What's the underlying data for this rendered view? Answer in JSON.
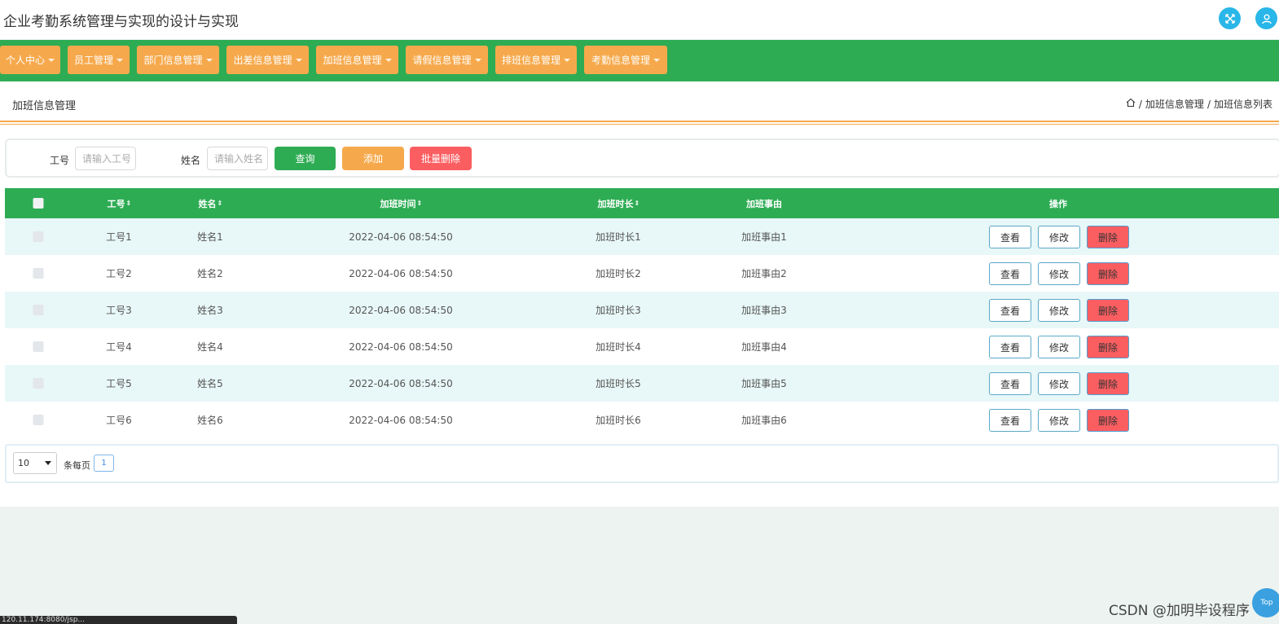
{
  "app": {
    "title": "企业考勤系统管理与实现的设计与实现"
  },
  "header_icons": [
    {
      "name": "fullscreen-icon"
    },
    {
      "name": "user-icon"
    }
  ],
  "nav": {
    "items": [
      {
        "label": "个人中心"
      },
      {
        "label": "员工管理"
      },
      {
        "label": "部门信息管理"
      },
      {
        "label": "出差信息管理"
      },
      {
        "label": "加班信息管理"
      },
      {
        "label": "请假信息管理"
      },
      {
        "label": "排班信息管理"
      },
      {
        "label": "考勤信息管理"
      }
    ]
  },
  "page": {
    "title": "加班信息管理",
    "breadcrumb": {
      "home_icon": "home-icon",
      "sep": "/",
      "level1": "加班信息管理",
      "level2": "加班信息列表"
    }
  },
  "search": {
    "employee_id_label": "工号",
    "employee_id_placeholder": "请输入工号",
    "name_label": "姓名",
    "name_placeholder": "请输入姓名",
    "query_button": "查询",
    "add_button": "添加",
    "batch_delete_button": "批量删除"
  },
  "table": {
    "columns": {
      "employee_id": "工号",
      "name": "姓名",
      "overtime_time": "加班时间",
      "overtime_duration": "加班时长",
      "overtime_reason": "加班事由",
      "actions": "操作"
    },
    "sort_icon": "⇕",
    "rows": [
      {
        "employee_id": "工号1",
        "name": "姓名1",
        "overtime_time": "2022-04-06 08:54:50",
        "overtime_duration": "加班时长1",
        "overtime_reason": "加班事由1"
      },
      {
        "employee_id": "工号2",
        "name": "姓名2",
        "overtime_time": "2022-04-06 08:54:50",
        "overtime_duration": "加班时长2",
        "overtime_reason": "加班事由2"
      },
      {
        "employee_id": "工号3",
        "name": "姓名3",
        "overtime_time": "2022-04-06 08:54:50",
        "overtime_duration": "加班时长3",
        "overtime_reason": "加班事由3"
      },
      {
        "employee_id": "工号4",
        "name": "姓名4",
        "overtime_time": "2022-04-06 08:54:50",
        "overtime_duration": "加班时长4",
        "overtime_reason": "加班事由4"
      },
      {
        "employee_id": "工号5",
        "name": "姓名5",
        "overtime_time": "2022-04-06 08:54:50",
        "overtime_duration": "加班时长5",
        "overtime_reason": "加班事由5"
      },
      {
        "employee_id": "工号6",
        "name": "姓名6",
        "overtime_time": "2022-04-06 08:54:50",
        "overtime_duration": "加班时长6",
        "overtime_reason": "加班事由6"
      }
    ],
    "action_labels": {
      "view": "查看",
      "edit": "修改",
      "delete": "删除"
    }
  },
  "pagination": {
    "page_size": "10",
    "per_page_label": "条每页",
    "current_page": "1"
  },
  "status_bar_url": "120.11.174:8080/jsp...",
  "watermark": "CSDN @加明毕设程序",
  "top_button": "Top",
  "colors": {
    "nav_bg": "#2eac54",
    "nav_item_bg": "#f6a94c",
    "query_btn": "#2eac54",
    "add_btn": "#f6a94c",
    "batch_delete_btn": "#fb5e61",
    "row_alt_bg": "#e8f7f7",
    "accent_icon": "#29b6e8"
  }
}
